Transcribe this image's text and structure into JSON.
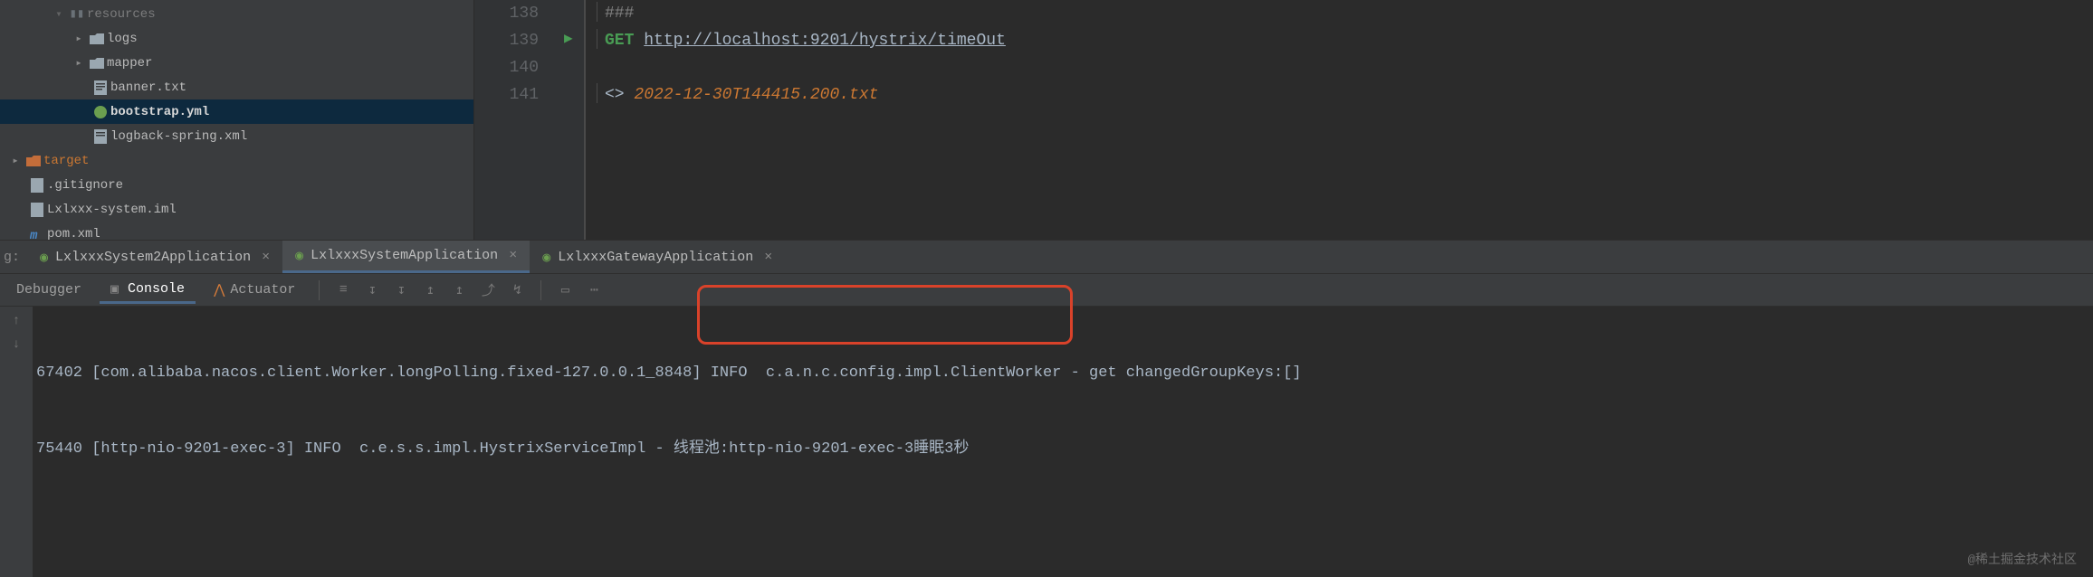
{
  "tree": {
    "resources_last": "resources",
    "logs": "logs",
    "mapper": "mapper",
    "banner": "banner.txt",
    "bootstrap": "bootstrap.yml",
    "logback": "logback-spring.xml",
    "target": "target",
    "gitignore": ".gitignore",
    "iml": "Lxlxxx-system.iml",
    "pom": "pom.xml"
  },
  "editor": {
    "lines": {
      "l138": "138",
      "l139": "139",
      "l140": "140",
      "l141": "141"
    },
    "hash": "###",
    "method": "GET",
    "url": "http://localhost:9201/hystrix/timeOut",
    "angle": "<>",
    "file": "2022-12-30T144415.200.txt"
  },
  "tabs": {
    "prefix": "g:",
    "t1": "LxlxxxSystem2Application",
    "t2": "LxlxxxSystemApplication",
    "t3": "LxlxxxGatewayApplication",
    "close": "×"
  },
  "tool": {
    "debugger": "Debugger",
    "console": "Console",
    "actuator": "Actuator"
  },
  "console": {
    "line1": "67402 [com.alibaba.nacos.client.Worker.longPolling.fixed-127.0.0.1_8848] INFO  c.a.n.c.config.impl.ClientWorker - get changedGroupKeys:[]",
    "line2": "75440 [http-nio-9201-exec-3] INFO  c.e.s.s.impl.HystrixServiceImpl - 线程池:http-nio-9201-exec-3睡眠3秒"
  },
  "watermark": "@稀土掘金技术社区"
}
